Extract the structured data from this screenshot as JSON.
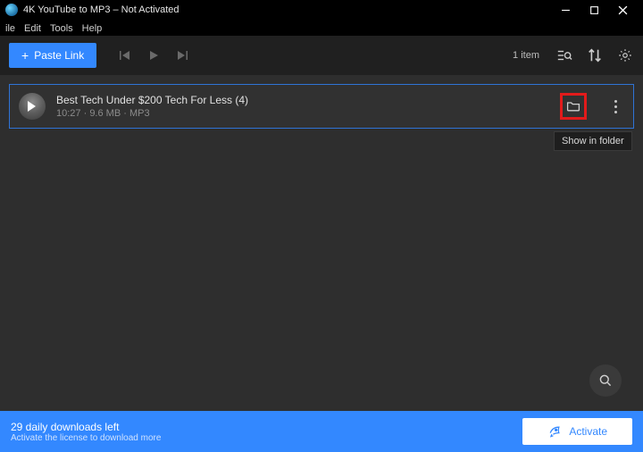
{
  "window": {
    "title": "4K YouTube to MP3 – Not Activated"
  },
  "menu": {
    "file": "ile",
    "edit": "Edit",
    "tools": "Tools",
    "help": "Help"
  },
  "toolbar": {
    "paste_label": "Paste Link",
    "item_count": "1 item"
  },
  "track": {
    "title": "Best Tech Under $200  Tech For Less (4)",
    "duration": "10:27",
    "size": "9.6 MB",
    "format": "MP3"
  },
  "tooltip": {
    "show_in_folder": "Show in folder"
  },
  "footer": {
    "downloads_left": "29 daily downloads left",
    "subtitle": "Activate the license to download more",
    "activate_label": "Activate"
  }
}
